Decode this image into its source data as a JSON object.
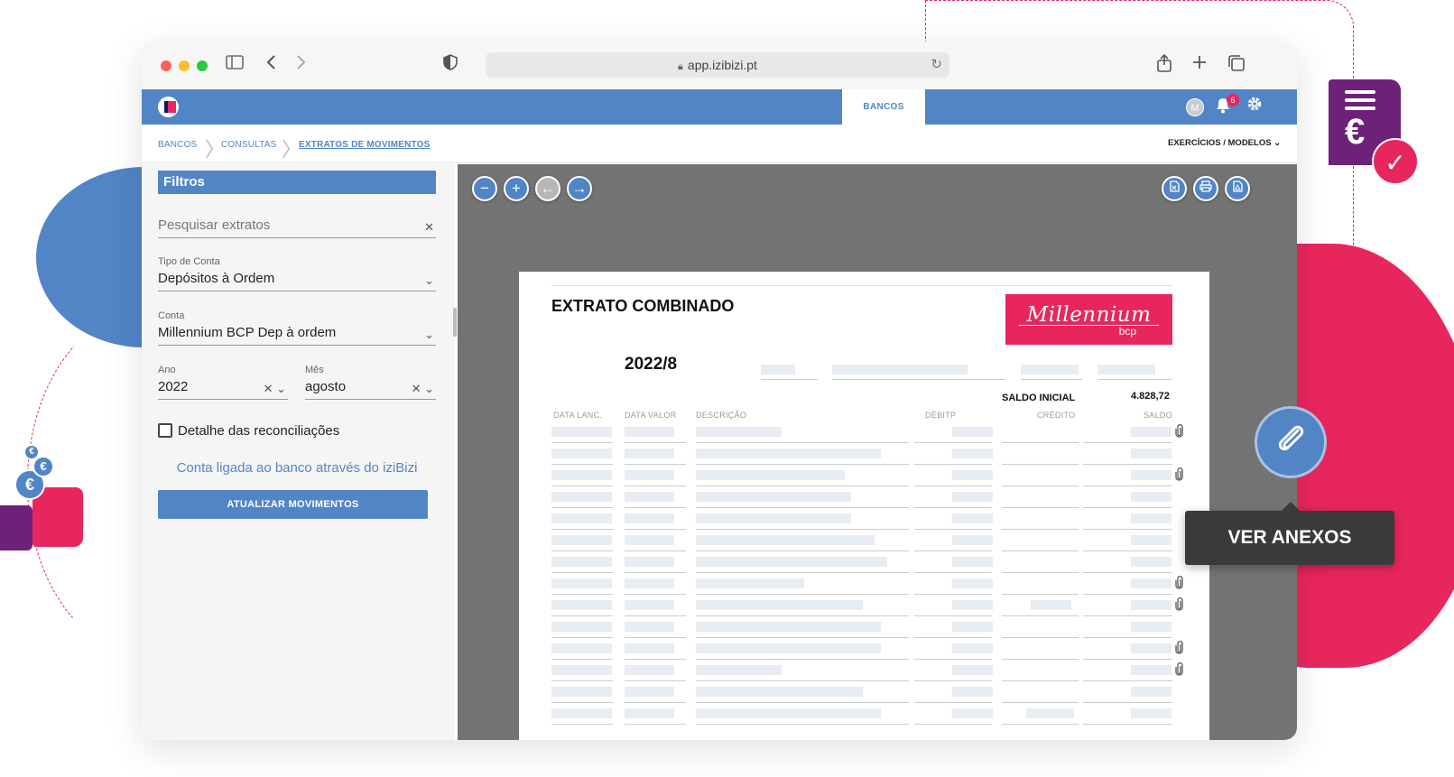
{
  "browser": {
    "url": "app.izibizi.pt"
  },
  "appbar": {
    "active_tab": "BANCOS",
    "avatar_initial": "M",
    "notification_count": "6"
  },
  "breadcrumb": {
    "items": [
      "BANCOS",
      "CONSULTAS",
      "EXTRATOS DE MOVIMENTOS"
    ],
    "exercicios": "EXERCÍCIOS / MODELOS"
  },
  "sidebar": {
    "header": "Filtros",
    "search_placeholder": "Pesquisar extratos",
    "tipo_conta": {
      "label": "Tipo de Conta",
      "value": "Depósitos à Ordem"
    },
    "conta": {
      "label": "Conta",
      "value": "Millennium BCP Dep à ordem"
    },
    "ano": {
      "label": "Ano",
      "value": "2022"
    },
    "mes": {
      "label": "Mês",
      "value": "agosto"
    },
    "detalhe_label": "Detalhe das reconciliações",
    "linked_text": "Conta ligada ao banco através do iziBizi",
    "update_button": "ATUALIZAR MOVIMENTOS"
  },
  "document": {
    "title": "EXTRATO COMBINADO",
    "period": "2022/8",
    "bank_name": "Millennium",
    "bank_sub": "bcp",
    "saldo_inicial_label": "SALDO INICIAL",
    "saldo_inicial_value": "4.828,72",
    "columns": [
      "DATA LANC.",
      "DATA VALOR",
      "DESCRIÇÃO",
      "DÉBITP",
      "CRÉDITO",
      "SALDO"
    ]
  },
  "callout": {
    "tooltip": "VER ANEXOS"
  },
  "colors": {
    "brand_blue": "#5285c6",
    "brand_pink": "#e8265e",
    "brand_purple": "#6d2178"
  }
}
